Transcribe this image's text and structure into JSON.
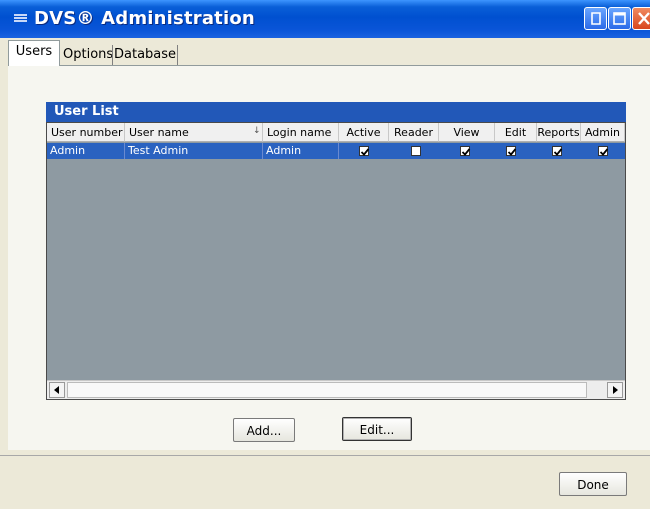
{
  "window": {
    "title": "DVS® Administration"
  },
  "tabs": [
    {
      "label": "Users",
      "selected": true
    },
    {
      "label": "Options",
      "selected": false
    },
    {
      "label": "Database",
      "selected": false
    }
  ],
  "user_list": {
    "title": "User List",
    "columns": [
      "User number",
      "User name",
      "Login name",
      "Active",
      "Reader",
      "View",
      "Edit",
      "Reports",
      "Admin"
    ],
    "rows": [
      {
        "user_number": "Admin",
        "user_name": "Test Admin",
        "login_name": "Admin",
        "active": true,
        "reader": false,
        "view": true,
        "edit": true,
        "reports": true,
        "admin": true,
        "selected": true
      }
    ]
  },
  "buttons": {
    "add": "Add...",
    "edit": "Edit...",
    "done": "Done"
  },
  "colors": {
    "titlebar": "#0050d0",
    "list_header": "#2258b8",
    "selected_row": "#2a62c0",
    "grid_background": "#8e9aa2",
    "close_button": "#d8461e"
  },
  "icons": [
    "app-icon",
    "minimize-icon",
    "maximize-icon",
    "close-icon",
    "checkmark-icon",
    "arrow-left-icon",
    "arrow-right-icon",
    "sort-indicator-icon"
  ]
}
